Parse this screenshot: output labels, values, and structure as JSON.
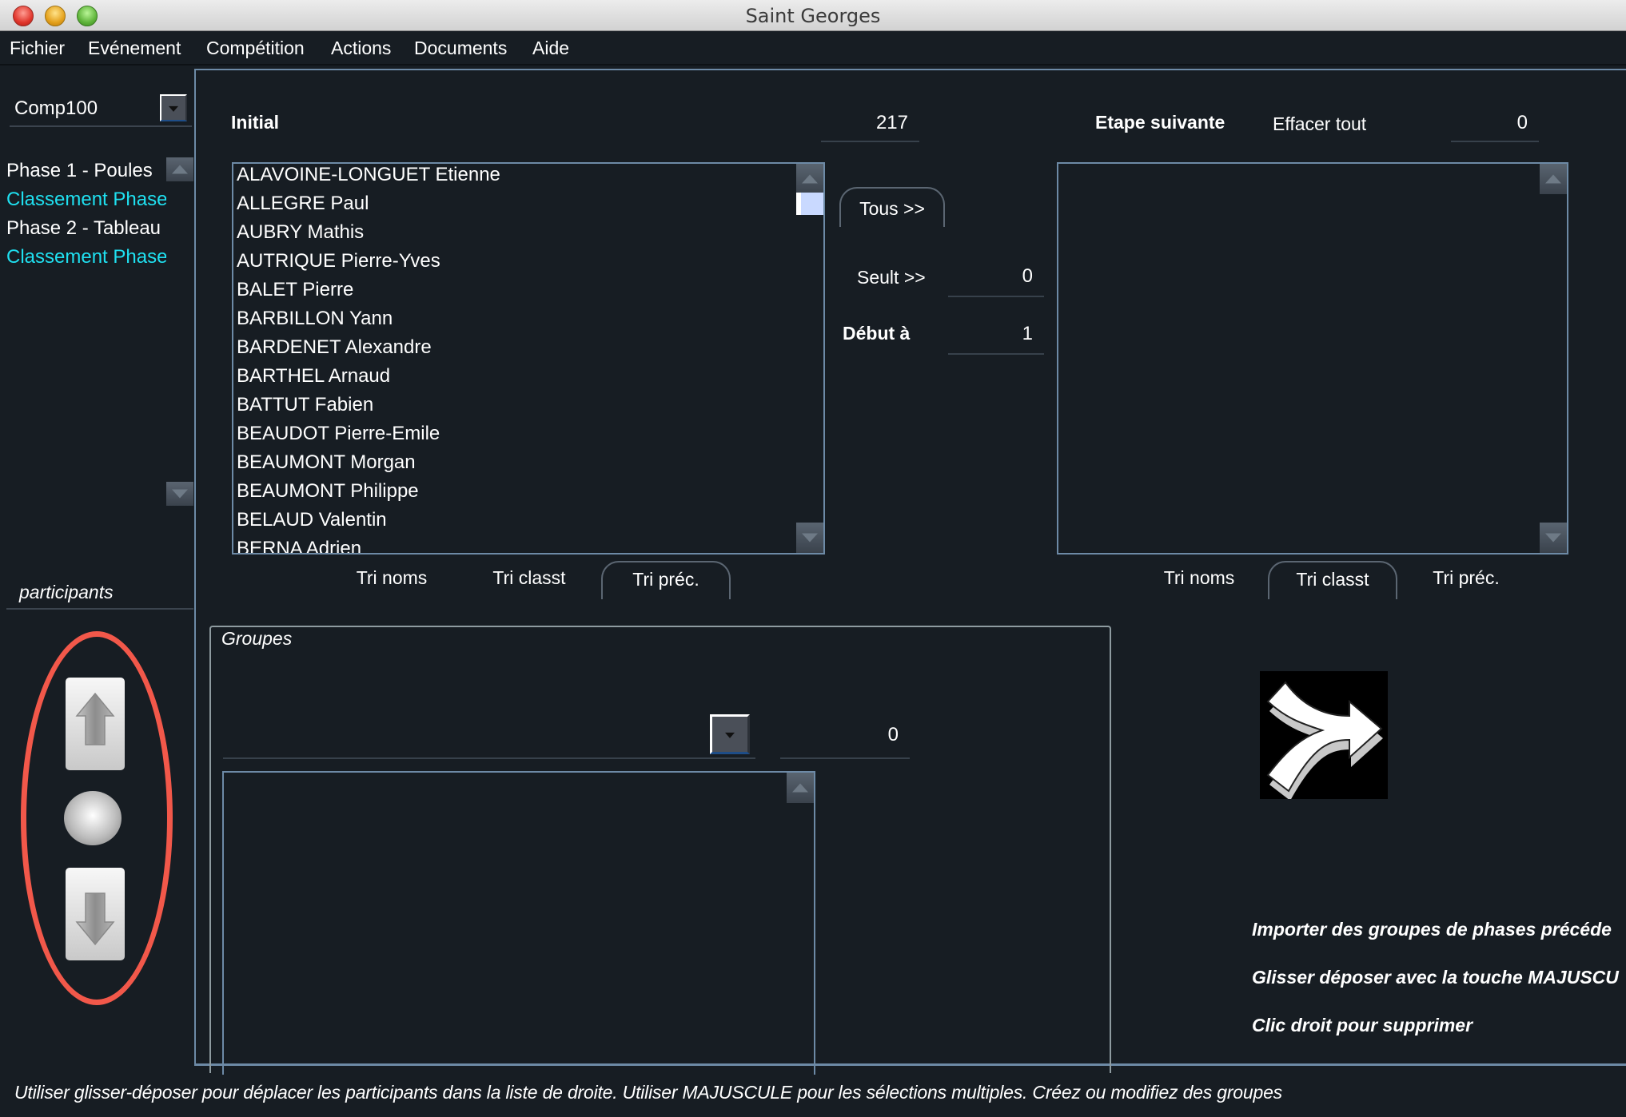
{
  "window": {
    "title": "Saint Georges"
  },
  "menu": [
    "Fichier",
    "Evénement",
    "Compétition",
    "Actions",
    "Documents",
    "Aide"
  ],
  "sidebar": {
    "competition": "Comp100",
    "phases": [
      {
        "label": "Phase 1 - Poules",
        "kind": "phase"
      },
      {
        "label": "Classement Phase",
        "kind": "ranking"
      },
      {
        "label": "Phase 2 - Tableau",
        "kind": "phase"
      },
      {
        "label": "Classement Phase",
        "kind": "ranking"
      }
    ],
    "participants_label": "participants",
    "move_buttons": {
      "up": "move-up",
      "center": "move-reset",
      "down": "move-down"
    },
    "highlight_color": "#f2584a"
  },
  "initial": {
    "label": "Initial",
    "count": "217",
    "participants": [
      "ALAVOINE-LONGUET Etienne",
      "ALLEGRE Paul",
      "AUBRY Mathis",
      "AUTRIQUE Pierre-Yves",
      "BALET Pierre",
      "BARBILLON Yann",
      "BARDENET Alexandre",
      "BARTHEL Arnaud",
      "BATTUT Fabien",
      "BEAUDOT Pierre-Emile",
      "BEAUMONT Morgan",
      "BEAUMONT Philippe",
      "BELAUD Valentin",
      "BERNA Adrien"
    ],
    "sort_tabs": [
      "Tri noms",
      "Tri classt",
      "Tri préc."
    ],
    "active_sort": 2
  },
  "transfer": {
    "all_label": "Tous >>",
    "only_label": "Seult >>",
    "only_value": "0",
    "start_label": "Début à",
    "start_value": "1"
  },
  "next_stage": {
    "label": "Etape suivante",
    "clear_label": "Effacer tout",
    "count": "0",
    "participants": [],
    "sort_tabs": [
      "Tri noms",
      "Tri classt",
      "Tri préc."
    ],
    "active_sort": 1
  },
  "groups": {
    "label": "Groupes",
    "selected": "",
    "count": "0",
    "items": []
  },
  "hints": [
    "Importer des groupes de phases précéde",
    "Glisser déposer avec la touche MAJUSCU",
    "Clic droit pour supprimer"
  ],
  "status": "Utiliser glisser-déposer pour déplacer les participants dans la liste de droite. Utiliser MAJUSCULE pour les sélections multiples. Créez ou modifiez des groupes",
  "colors": {
    "background": "#171d23",
    "border": "#6d8aa6",
    "ranking_text": "#1fe0f0"
  }
}
